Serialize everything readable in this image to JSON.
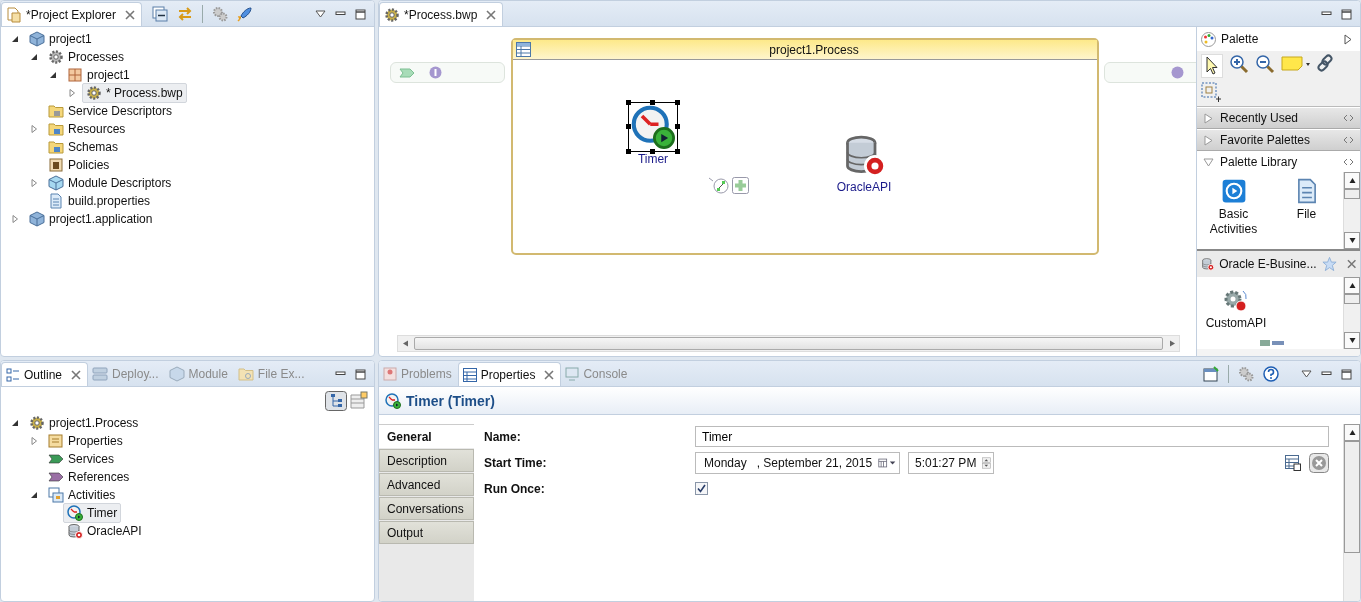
{
  "explorer": {
    "tab": {
      "label": "*Project Explorer",
      "selected": true
    },
    "tree": [
      {
        "kind": "project",
        "label": "project1",
        "expanded": true,
        "selected": false,
        "children": [
          {
            "kind": "processes",
            "label": "Processes",
            "expanded": true,
            "selected": false,
            "children": [
              {
                "kind": "package",
                "label": "project1",
                "expanded": true,
                "selected": false,
                "children": [
                  {
                    "kind": "process",
                    "label": "* Process.bwp",
                    "expanded": false,
                    "selected": true
                  }
                ]
              }
            ]
          },
          {
            "kind": "descriptors",
            "label": "Service Descriptors",
            "selected": false
          },
          {
            "kind": "folder",
            "label": "Resources",
            "expanded": false,
            "selected": false
          },
          {
            "kind": "folder",
            "label": "Schemas",
            "selected": false
          },
          {
            "kind": "policy",
            "label": "Policies",
            "selected": false
          },
          {
            "kind": "module",
            "label": "Module Descriptors",
            "expanded": false,
            "selected": false
          },
          {
            "kind": "file",
            "label": "build.properties",
            "selected": false
          }
        ]
      },
      {
        "kind": "project",
        "label": "project1.application",
        "expanded": false,
        "selected": false
      }
    ]
  },
  "editor": {
    "tab": {
      "label": "*Process.bwp",
      "selected": true
    },
    "process": {
      "title": "project1.Process",
      "activities": [
        {
          "kind": "timer",
          "label": "Timer",
          "selected": true
        },
        {
          "kind": "database",
          "label": "OracleAPI",
          "selected": false
        }
      ]
    },
    "palette": {
      "title": "Palette",
      "drawers": [
        {
          "label": "Recently Used",
          "expanded": false
        },
        {
          "label": "Favorite Palettes",
          "expanded": false
        },
        {
          "label": "Palette Library",
          "expanded": true,
          "items": [
            {
              "kind": "play",
              "label": "Basic Activities"
            },
            {
              "kind": "file",
              "label": "File"
            }
          ]
        }
      ],
      "plugin": {
        "title": "Oracle E-Busine...",
        "items": [
          {
            "label": "CustomAPI"
          }
        ]
      }
    }
  },
  "outline": {
    "tabs": [
      {
        "label": "Outline",
        "selected": true
      },
      {
        "label": "Deploy...",
        "selected": false
      },
      {
        "label": "Module",
        "selected": false
      },
      {
        "label": "File Ex...",
        "selected": false
      }
    ],
    "tree": [
      {
        "kind": "process",
        "label": "project1.Process",
        "expanded": true,
        "selected": false,
        "children": [
          {
            "kind": "properties",
            "label": "Properties",
            "expanded": false,
            "selected": false
          },
          {
            "kind": "service",
            "label": "Services",
            "selected": false
          },
          {
            "kind": "reference",
            "label": "References",
            "selected": false
          },
          {
            "kind": "activities",
            "label": "Activities",
            "expanded": true,
            "selected": false,
            "children": [
              {
                "kind": "timer",
                "label": "Timer",
                "selected": true
              },
              {
                "kind": "database",
                "label": "OracleAPI",
                "selected": false
              }
            ]
          }
        ]
      }
    ]
  },
  "properties_view": {
    "tabs": [
      {
        "label": "Problems",
        "selected": false
      },
      {
        "label": "Properties",
        "selected": true
      },
      {
        "label": "Console",
        "selected": false
      }
    ],
    "title": "Timer (Timer)",
    "sections": [
      {
        "label": "General",
        "selected": true
      },
      {
        "label": "Description",
        "selected": false
      },
      {
        "label": "Advanced",
        "selected": false
      },
      {
        "label": "Conversations",
        "selected": false
      },
      {
        "label": "Output",
        "selected": false
      }
    ],
    "fields": [
      {
        "kind": "text",
        "label": "Name:",
        "value": "Timer"
      },
      {
        "kind": "datetime",
        "label": "Start Time:",
        "date": "Monday   , September 21, 2015",
        "time": "5:01:27 PM"
      },
      {
        "kind": "checkbox",
        "label": "Run Once:",
        "checked": true
      }
    ]
  }
}
